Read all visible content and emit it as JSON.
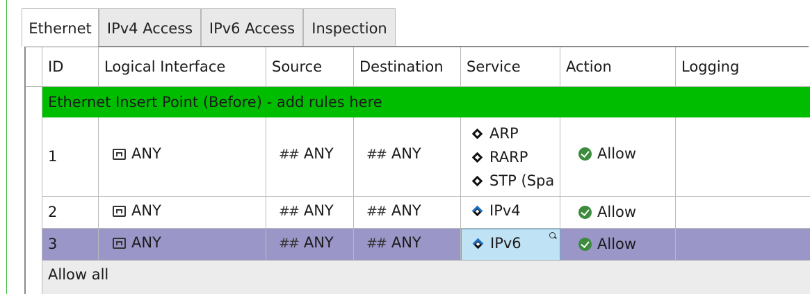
{
  "tabs": [
    {
      "label": "Ethernet",
      "active": true
    },
    {
      "label": "IPv4 Access",
      "active": false
    },
    {
      "label": "IPv6 Access",
      "active": false
    },
    {
      "label": "Inspection",
      "active": false
    }
  ],
  "columns": [
    "ID",
    "Logical Interface",
    "Source",
    "Destination",
    "Service",
    "Action",
    "Logging"
  ],
  "insert_point": "Ethernet Insert Point (Before) - add rules here",
  "rules": [
    {
      "id": "1",
      "interface": "ANY",
      "source": "ANY",
      "destination": "ANY",
      "services": [
        "ARP",
        "RARP",
        "STP (Spa"
      ],
      "action": "Allow"
    },
    {
      "id": "2",
      "interface": "ANY",
      "source": "ANY",
      "destination": "ANY",
      "services": [
        "IPv4"
      ],
      "action": "Allow"
    },
    {
      "id": "3",
      "interface": "ANY",
      "source": "ANY",
      "destination": "ANY",
      "services": [
        "IPv6"
      ],
      "action": "Allow",
      "selected": true
    }
  ],
  "footer_row": "Allow all",
  "colors": {
    "insert_row": "#00bd00",
    "selected_row": "#9b96c8",
    "selected_cell": "#bfe2f5",
    "allow_icon": "#3d8b3d"
  },
  "icons": {
    "interface": "network-interface-icon",
    "address": "any-network-icon",
    "service": "service-diamond-icon",
    "ip_service": "ip-service-icon",
    "action": "allow-check-icon",
    "search": "magnifier-icon"
  }
}
